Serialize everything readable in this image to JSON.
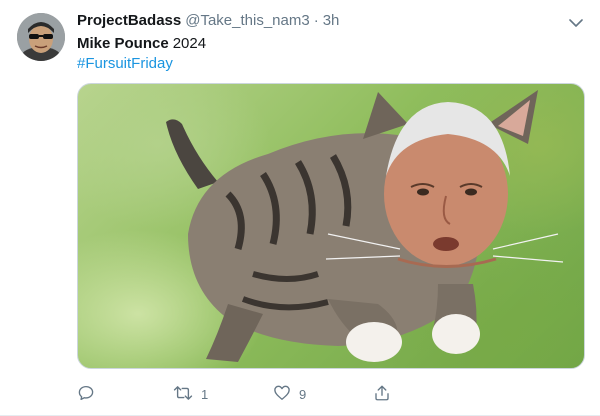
{
  "tweet": {
    "display_name": "ProjectBadass",
    "handle": "@Take_this_nam3",
    "separator": "·",
    "time": "3h",
    "text_bold": "Mike Pounce",
    "text_rest": "2024",
    "hashtag": "#FursuitFriday"
  },
  "actions": {
    "reply_count": "",
    "retweet_count": "1",
    "like_count": "9"
  },
  "icons": [
    "chevron-down-icon",
    "reply-icon",
    "retweet-icon",
    "like-icon",
    "share-icon"
  ],
  "colors": {
    "link": "#1b95e0",
    "secondary_text": "#657786",
    "primary_text": "#14171a"
  }
}
